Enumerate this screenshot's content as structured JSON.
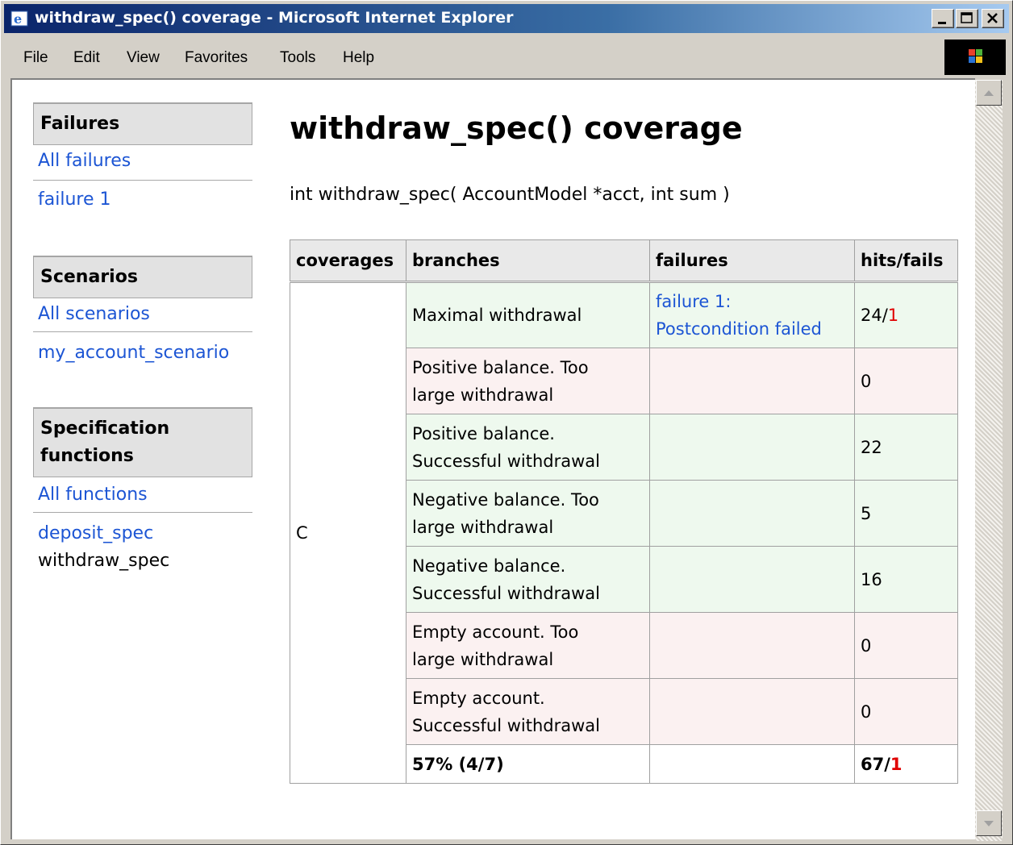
{
  "window": {
    "title": "withdraw_spec() coverage - Microsoft Internet Explorer",
    "icon": "ie-icon",
    "controls": [
      "minimize-icon",
      "maximize-icon",
      "close-icon"
    ]
  },
  "menu": {
    "file": "File",
    "edit": "Edit",
    "view": "View",
    "favorites": "Favorites",
    "tools": "Tools",
    "help": "Help"
  },
  "sidebar": {
    "failures": {
      "heading": "Failures",
      "links": [
        "All failures",
        "failure 1"
      ]
    },
    "scenarios": {
      "heading": "Scenarios",
      "links": [
        "All scenarios",
        "my_account_scenario"
      ]
    },
    "functions": {
      "heading_line1": "Specification",
      "heading_line2": "functions",
      "links": [
        "All functions",
        "deposit_spec"
      ],
      "current": "withdraw_spec"
    }
  },
  "main": {
    "title": "withdraw_spec() coverage",
    "signature": "int withdraw_spec( AccountModel *acct, int sum )"
  },
  "table": {
    "headers": [
      "coverages",
      "branches",
      "failures",
      "hits/fails"
    ],
    "coverage_name": "C",
    "rows": [
      {
        "line1": "Maximal withdrawal",
        "line2": "",
        "failure_line1": "failure 1:",
        "failure_line2": "Postcondition failed",
        "hits": "24/",
        "fails": "1",
        "status": "green"
      },
      {
        "line1": "Positive balance. Too",
        "line2": "large withdrawal",
        "failure_line1": "",
        "failure_line2": "",
        "hits": "0",
        "fails": "",
        "status": "red"
      },
      {
        "line1": "Positive balance.",
        "line2": "Successful withdrawal",
        "failure_line1": "",
        "failure_line2": "",
        "hits": "22",
        "fails": "",
        "status": "green"
      },
      {
        "line1": "Negative balance. Too",
        "line2": "large withdrawal",
        "failure_line1": "",
        "failure_line2": "",
        "hits": "5",
        "fails": "",
        "status": "green"
      },
      {
        "line1": "Negative balance.",
        "line2": "Successful withdrawal",
        "failure_line1": "",
        "failure_line2": "",
        "hits": "16",
        "fails": "",
        "status": "green"
      },
      {
        "line1": "Empty account. Too",
        "line2": "large withdrawal",
        "failure_line1": "",
        "failure_line2": "",
        "hits": "0",
        "fails": "",
        "status": "red"
      },
      {
        "line1": "Empty account.",
        "line2": "Successful withdrawal",
        "failure_line1": "",
        "failure_line2": "",
        "hits": "0",
        "fails": "",
        "status": "red"
      }
    ],
    "total": {
      "branches": "57% (4/7)",
      "hits": "67/",
      "fails": "1"
    }
  },
  "colors": {
    "link": "#1c55d4",
    "covered_row": "#eef9ee",
    "uncovered_row": "#fbf1f1",
    "fail_count": "#e00000",
    "titlebar_start": "#0a246a"
  }
}
